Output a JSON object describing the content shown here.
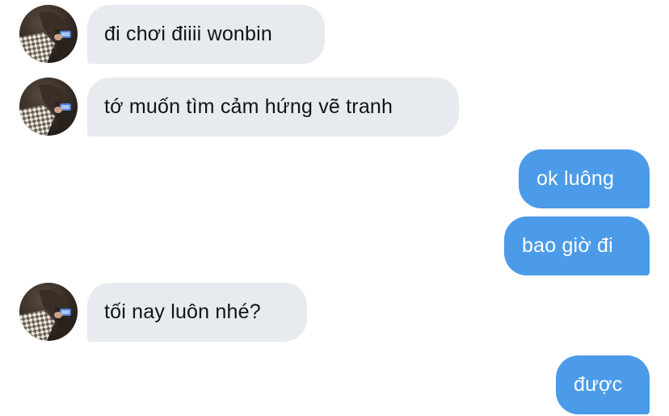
{
  "conversation": {
    "messages": [
      {
        "sender": "other",
        "text": "đi chơi điiii wonbin"
      },
      {
        "sender": "other",
        "text": "tớ muốn tìm cảm hứng vẽ tranh"
      },
      {
        "sender": "me",
        "text": "ok luông"
      },
      {
        "sender": "me",
        "text": "bao giờ đi"
      },
      {
        "sender": "other",
        "text": "tối nay luôn nhé?"
      },
      {
        "sender": "me",
        "text": "được"
      }
    ]
  },
  "colors": {
    "incoming_bubble": "#e7ebef",
    "outgoing_bubble": "#4c9be8",
    "incoming_text": "#0f1419",
    "outgoing_text": "#ffffff"
  },
  "icons": {
    "avatar": "user-photo-avatar"
  }
}
